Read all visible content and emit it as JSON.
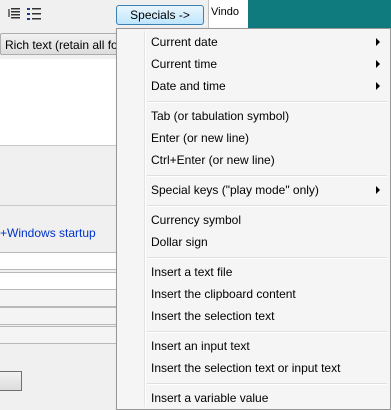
{
  "toolbar": {
    "specials_label": "Specials ->",
    "icons": [
      "align-icon",
      "bulleted-list-icon"
    ]
  },
  "editor": {
    "format_value": "Rich text (retain all formatting)",
    "link_text": "+Windows startup"
  },
  "background_window": {
    "title_fragment": "Vindo"
  },
  "menu": {
    "items": [
      {
        "label": "Current date",
        "submenu": true
      },
      {
        "label": "Current time",
        "submenu": true
      },
      {
        "label": "Date and time",
        "submenu": true
      },
      {
        "label": "Tab (or tabulation symbol)",
        "submenu": false
      },
      {
        "label": "Enter (or new line)",
        "submenu": false
      },
      {
        "label": "Ctrl+Enter (or new line)",
        "submenu": false
      },
      {
        "label": "Special keys (\"play mode\" only)",
        "submenu": true
      },
      {
        "label": "Currency symbol",
        "submenu": false
      },
      {
        "label": "Dollar sign",
        "submenu": false
      },
      {
        "label": "Insert a text file",
        "submenu": false
      },
      {
        "label": "Insert the clipboard content",
        "submenu": false
      },
      {
        "label": "Insert the selection text",
        "submenu": false
      },
      {
        "label": "Insert an input text",
        "submenu": false
      },
      {
        "label": "Insert the selection text or input text",
        "submenu": false
      },
      {
        "label": "Insert a variable value",
        "submenu": false
      }
    ]
  },
  "colors": {
    "accent_teal": "#0f7b7f",
    "link_blue": "#0033cc"
  }
}
